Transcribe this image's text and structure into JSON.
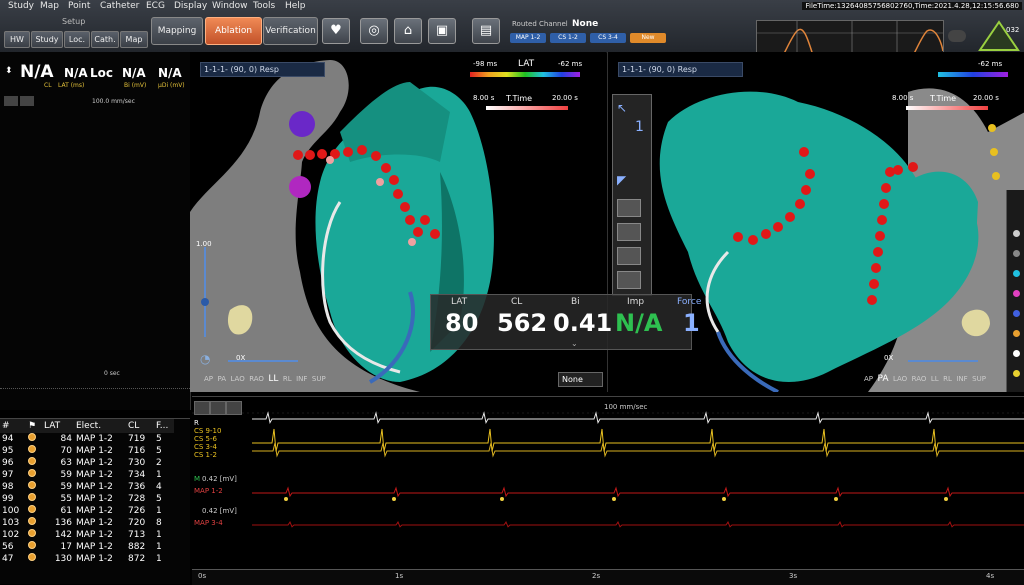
{
  "menu": [
    "Study",
    "Map",
    "Point",
    "Catheter",
    "ECG",
    "Display",
    "Window",
    "Tools",
    "Help"
  ],
  "setup": {
    "title": "Setup",
    "buttons": [
      "HW",
      "Study",
      "Loc.",
      "Cath.",
      "Map"
    ]
  },
  "modes": [
    "Mapping",
    "Ablation",
    "Verification"
  ],
  "active_mode": "Ablation",
  "routed": {
    "label": "Routed Channel",
    "value": "None",
    "chips": [
      "MAP 1-2",
      "CS 1-2",
      "CS 3-4",
      "New"
    ]
  },
  "filetime": "FileTime:13264085756802760,Time:2021.4.28,12:15:56.680",
  "badge": "032",
  "left_panel": {
    "values": [
      {
        "val": "N/A",
        "lbl": "CL"
      },
      {
        "val": "N/A",
        "lbl": "LAT (ms)"
      },
      {
        "val": "Loc",
        "lbl": ""
      },
      {
        "val": "N/A",
        "lbl": "Bi (mV)"
      },
      {
        "val": "N/A",
        "lbl": "µDi (mV)"
      }
    ],
    "speed": "100.0 mm/sec",
    "zero": "0 sec"
  },
  "view1": {
    "title": "1-1-1-   (90, 0)  Resp",
    "lat_min": "-98 ms",
    "lat_label": "LAT",
    "lat_max": "-62 ms",
    "ttime_min": "8.00 s",
    "ttime_label": "T.Time",
    "ttime_max": "20.00 s",
    "scale": "1.00",
    "scale_zero": "0X",
    "axes": [
      "AP",
      "PA",
      "LAO",
      "RAO",
      "LL",
      "RL",
      "INF",
      "SUP"
    ],
    "dropdown": "None"
  },
  "view2": {
    "title": "1-1-1-   (90, 0)  Resp",
    "lat_max": "-62 ms",
    "ttime_min": "8.00 s",
    "ttime_label": "T.Time",
    "ttime_max": "20.00 s",
    "scale_zero": "0X",
    "axes": [
      "AP",
      "PA",
      "LAO",
      "RAO",
      "LL",
      "RL",
      "INF",
      "SUP"
    ]
  },
  "readout": {
    "items": [
      {
        "label": "LAT",
        "value": "80"
      },
      {
        "label": "CL",
        "value": "562"
      },
      {
        "label": "Bi",
        "value": "0.41"
      },
      {
        "label": "Imp",
        "value": "N/A"
      },
      {
        "label": "Force",
        "value": "1"
      }
    ]
  },
  "table": {
    "headers": [
      "#",
      "",
      "LAT",
      "Elect.",
      "CL",
      "F..."
    ],
    "rows": [
      [
        "94",
        "",
        "84",
        "MAP 1-2",
        "719",
        "5"
      ],
      [
        "95",
        "",
        "70",
        "MAP 1-2",
        "716",
        "5"
      ],
      [
        "96",
        "",
        "63",
        "MAP 1-2",
        "730",
        "2"
      ],
      [
        "97",
        "",
        "59",
        "MAP 1-2",
        "734",
        "1"
      ],
      [
        "98",
        "",
        "59",
        "MAP 1-2",
        "736",
        "4"
      ],
      [
        "99",
        "",
        "55",
        "MAP 1-2",
        "728",
        "5"
      ],
      [
        "100",
        "",
        "61",
        "MAP 1-2",
        "726",
        "1"
      ],
      [
        "103",
        "",
        "136",
        "MAP 1-2",
        "720",
        "8"
      ],
      [
        "102",
        "",
        "142",
        "MAP 1-2",
        "713",
        "1"
      ],
      [
        "56",
        "",
        "17",
        "MAP 1-2",
        "882",
        "1"
      ],
      [
        "47",
        "",
        "130",
        "MAP 1-2",
        "872",
        "1"
      ]
    ]
  },
  "signals": {
    "speed": "100 mm/sec",
    "channels": [
      "R",
      "CS 9-10",
      "CS 5-6",
      "CS 3-4",
      "CS 1-2"
    ],
    "map12_label": "MAP 1-2",
    "map34_label": "MAP 3-4",
    "gain": "0.42 [mV]",
    "gain_m": "M",
    "time_ticks": [
      "0s",
      "1s",
      "2s",
      "3s",
      "4s"
    ]
  },
  "colors": {
    "accent": "#e8743a",
    "mesh": "#1aa898",
    "point": "#e01818",
    "ecg_cs": "#e8c020",
    "ecg_map": "#c01818"
  }
}
